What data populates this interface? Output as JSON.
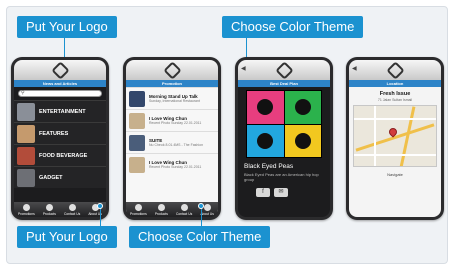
{
  "callouts": {
    "top_logo": "Put Your Logo",
    "top_theme": "Choose Color Theme",
    "bottom_logo": "Put Your Logo",
    "bottom_theme": "Choose Color Theme"
  },
  "screens": {
    "categories": {
      "ribbon": "News and Articles",
      "categories": [
        {
          "label": "ENTERTAINMENT",
          "color": "#8a8f98"
        },
        {
          "label": "FEATURES",
          "color": "#c59a6d"
        },
        {
          "label": "FOOD BEVERAGE",
          "color": "#b24c3a"
        },
        {
          "label": "GADGET",
          "color": "#6d6f75"
        }
      ]
    },
    "promotions": {
      "ribbon": "Promotion",
      "items": [
        {
          "title": "Morning Stand Up Talk",
          "subtitle": "Sunday, International Restaurant",
          "color": "#33476b"
        },
        {
          "title": "I Love Wing Chun",
          "subtitle": "Recent Photo Sunday 22.01.2011",
          "color": "#c7b08c"
        },
        {
          "title": "SUITE",
          "subtitle": "Nu Cheok 8.01.4MS - The Fashion",
          "color": "#4a5d7a"
        },
        {
          "title": "I Love Wing Chun",
          "subtitle": "Recent Photo Sunday 22.01.2011",
          "color": "#c7b08c"
        }
      ]
    },
    "detail": {
      "ribbon": "Best Deal Plan",
      "album_colors": [
        "#e83e7f",
        "#2bb24c",
        "#22a7df",
        "#f2c81f"
      ],
      "title": "Black Eyed Peas",
      "text": "Black Eyed Peas are an American hip hop group",
      "share_f": "f",
      "share_mail": "✉"
    },
    "location": {
      "ribbon": "Location",
      "title": "Fresh Issue",
      "address": "71 Jalan Sultan Ismail",
      "footer": "Navigate"
    }
  },
  "tabbar": {
    "items": [
      {
        "label": "Promotions",
        "icon": "info-icon"
      },
      {
        "label": "Products",
        "icon": "products-icon"
      },
      {
        "label": "Contact Us",
        "icon": "phone-icon"
      },
      {
        "label": "About Us",
        "icon": "cog-icon"
      }
    ]
  },
  "colors": {
    "accent": "#1b92d0",
    "ribbon": "#2d84c8",
    "phone": "#2b2b2d"
  }
}
